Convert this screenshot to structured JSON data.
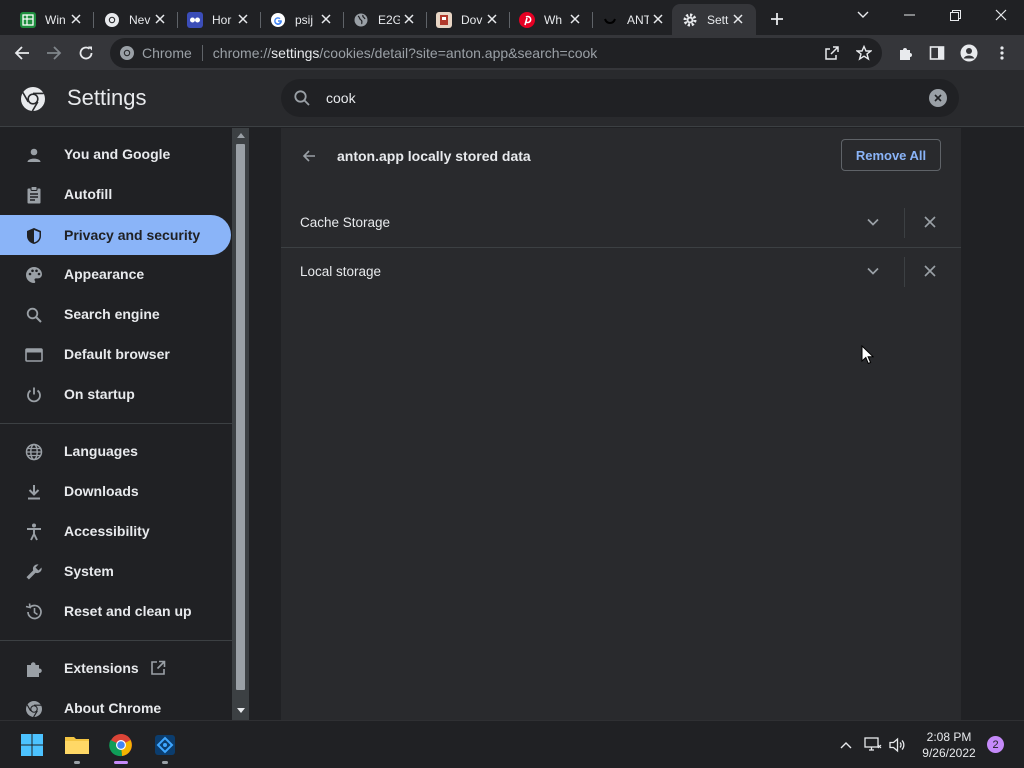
{
  "tabs": [
    {
      "title": "Win",
      "favicon": "sheets-icon",
      "color": "#1e8e3e"
    },
    {
      "title": "Nev",
      "favicon": "chrome-icon",
      "color": "#ffffff"
    },
    {
      "title": "Hor",
      "favicon": "site-icon",
      "color": "#3b4db8"
    },
    {
      "title": "psij",
      "favicon": "google-icon",
      "color": "#ffffff"
    },
    {
      "title": "E2G",
      "favicon": "globe-icon",
      "color": "#9aa0a6"
    },
    {
      "title": "Dov",
      "favicon": "site-icon",
      "color": "#e8d5c4"
    },
    {
      "title": "Wh",
      "favicon": "pinterest-icon",
      "color": "#e60023"
    },
    {
      "title": "ANT",
      "favicon": "smile-icon",
      "color": "#202124"
    },
    {
      "title": "Setti",
      "favicon": "gear-icon",
      "color": "#e8eaed"
    }
  ],
  "omnibox": {
    "site_label": "Chrome",
    "url_scheme": "chrome://",
    "url_host": "settings",
    "url_path": "/cookies/detail?site=anton.app&search=cook"
  },
  "header": {
    "title": "Settings",
    "search_value": "cook"
  },
  "sidebar": {
    "items": [
      {
        "label": "You and Google",
        "icon": "person-icon"
      },
      {
        "label": "Autofill",
        "icon": "clipboard-icon"
      },
      {
        "label": "Privacy and security",
        "icon": "shield-icon"
      },
      {
        "label": "Appearance",
        "icon": "palette-icon"
      },
      {
        "label": "Search engine",
        "icon": "search-icon"
      },
      {
        "label": "Default browser",
        "icon": "browser-icon"
      },
      {
        "label": "On startup",
        "icon": "power-icon"
      },
      {
        "label": "Languages",
        "icon": "globe-icon"
      },
      {
        "label": "Downloads",
        "icon": "download-icon"
      },
      {
        "label": "Accessibility",
        "icon": "accessibility-icon"
      },
      {
        "label": "System",
        "icon": "wrench-icon"
      },
      {
        "label": "Reset and clean up",
        "icon": "history-icon"
      },
      {
        "label": "Extensions",
        "icon": "puzzle-icon"
      },
      {
        "label": "About Chrome",
        "icon": "chrome-icon"
      }
    ],
    "selected": "Privacy and security"
  },
  "main": {
    "title": "anton.app locally stored data",
    "remove_all_label": "Remove All",
    "rows": [
      {
        "label": "Cache Storage"
      },
      {
        "label": "Local storage"
      }
    ]
  },
  "taskbar": {
    "time": "2:08 PM",
    "date": "9/26/2022",
    "notification_count": "2"
  },
  "colors": {
    "accent": "#8ab4f8",
    "background": "#202124",
    "card": "#292a2d"
  }
}
